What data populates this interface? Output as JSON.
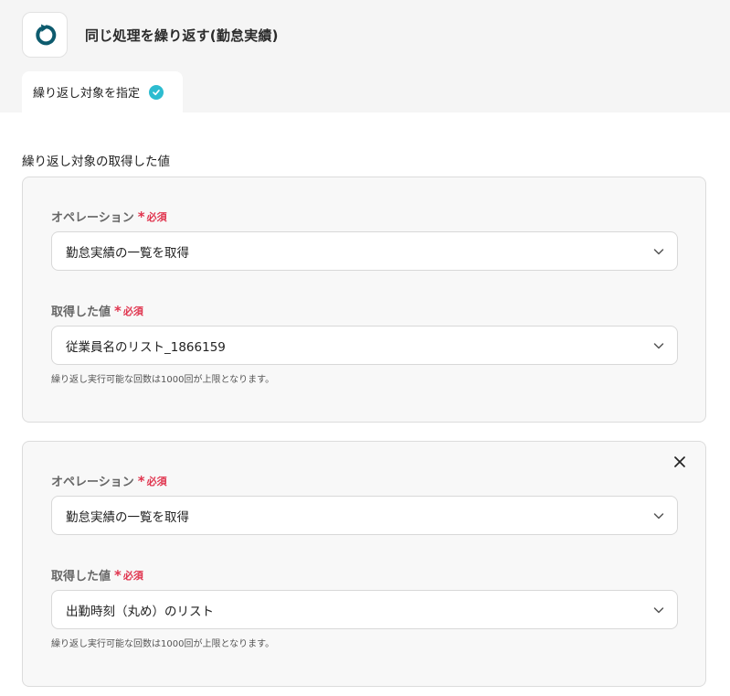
{
  "header": {
    "title": "同じ処理を繰り返す(勤怠実績)",
    "app_icon": "loop-icon",
    "accent_color": "#0d5b6e"
  },
  "tabs": [
    {
      "label": "繰り返し対象を指定",
      "status_icon": "check-circle-icon",
      "status_color": "#2dbcd0"
    }
  ],
  "section": {
    "title": "繰り返し対象の取得した値"
  },
  "required_star": "*",
  "required_text": "必須",
  "cards": [
    {
      "operation_label": "オペレーション",
      "operation_value": "勤怠実績の一覧を取得",
      "value_label": "取得した値",
      "value_value": "従業員名のリスト_1866159",
      "hint": "繰り返し実行可能な回数は1000回が上限となります。"
    },
    {
      "operation_label": "オペレーション",
      "operation_value": "勤怠実績の一覧を取得",
      "value_label": "取得した値",
      "value_value": "出勤時刻（丸め）のリスト",
      "hint": "繰り返し実行可能な回数は1000回が上限となります。",
      "removable": true
    }
  ]
}
